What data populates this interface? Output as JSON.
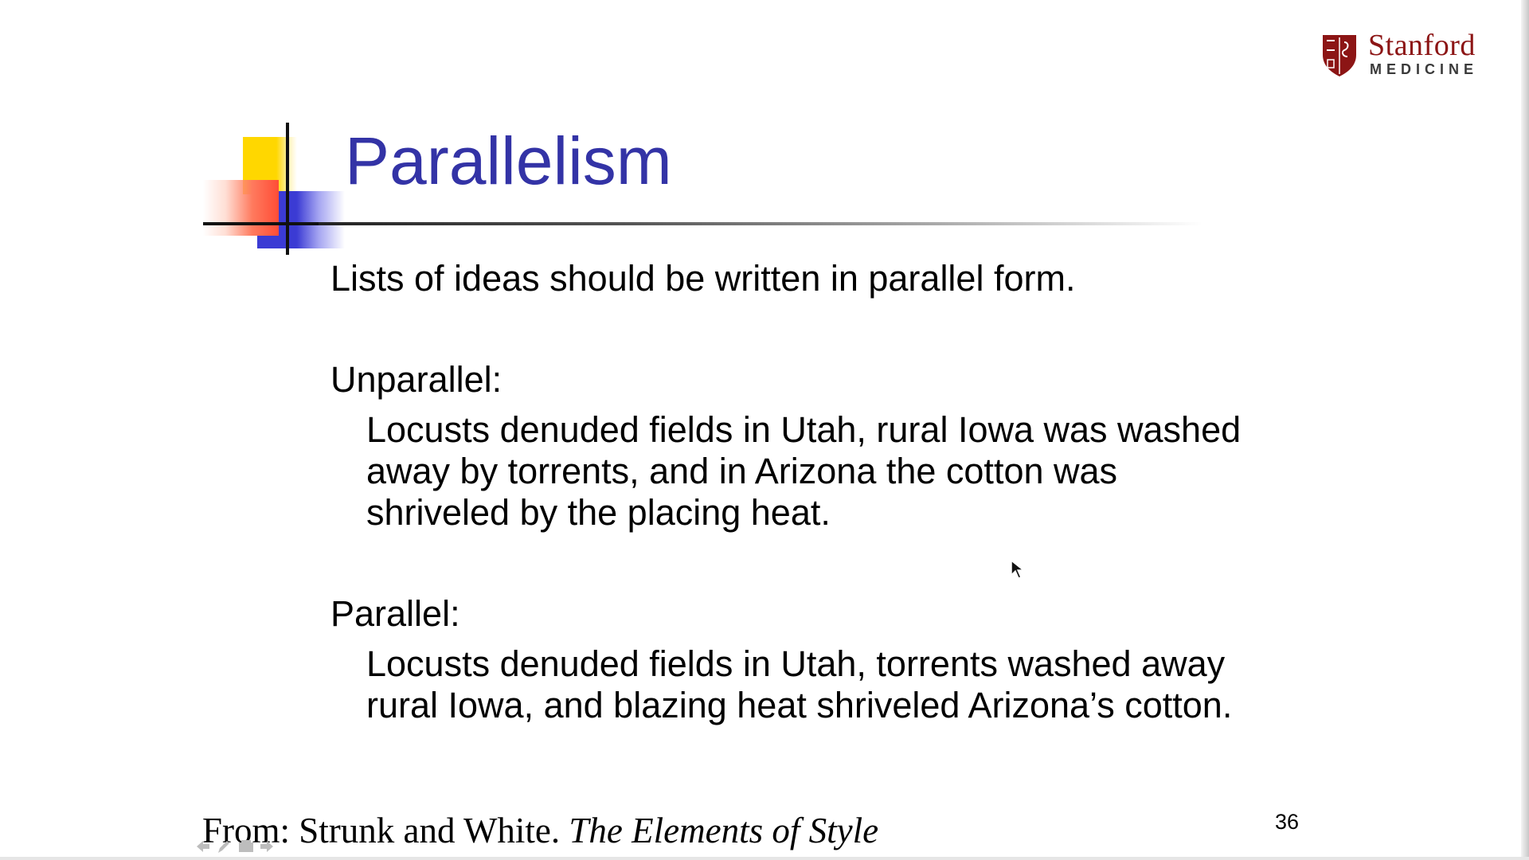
{
  "slide": {
    "title": "Parallelism",
    "intro": "Lists of ideas should be written in parallel form.",
    "unparallel": {
      "label": "Unparallel:",
      "lines": [
        "Locusts denuded fields in Utah, rural Iowa was washed",
        "away by torrents, and in Arizona the cotton was",
        "shriveled by the placing heat."
      ]
    },
    "parallel": {
      "label": "Parallel:",
      "lines": [
        "Locusts denuded fields in Utah, torrents washed away",
        "rural Iowa, and blazing heat shriveled Arizona’s cotton."
      ]
    },
    "source": {
      "prefix": "From: Strunk and White. ",
      "book": "The Elements of Style"
    },
    "page_number": "36"
  },
  "logo": {
    "name": "Stanford",
    "subtitle": "MEDICINE",
    "icon": "stanford-shield-icon"
  },
  "toolbar": {
    "icons": [
      "previous-slide-icon",
      "pen-icon",
      "menu-icon",
      "next-slide-icon"
    ]
  },
  "colors": {
    "title": "#3333a6",
    "brand": "#8c1515",
    "deco_yellow": "#ffd700",
    "deco_blue": "#3b3bd4",
    "deco_red": "#ff4d36"
  }
}
